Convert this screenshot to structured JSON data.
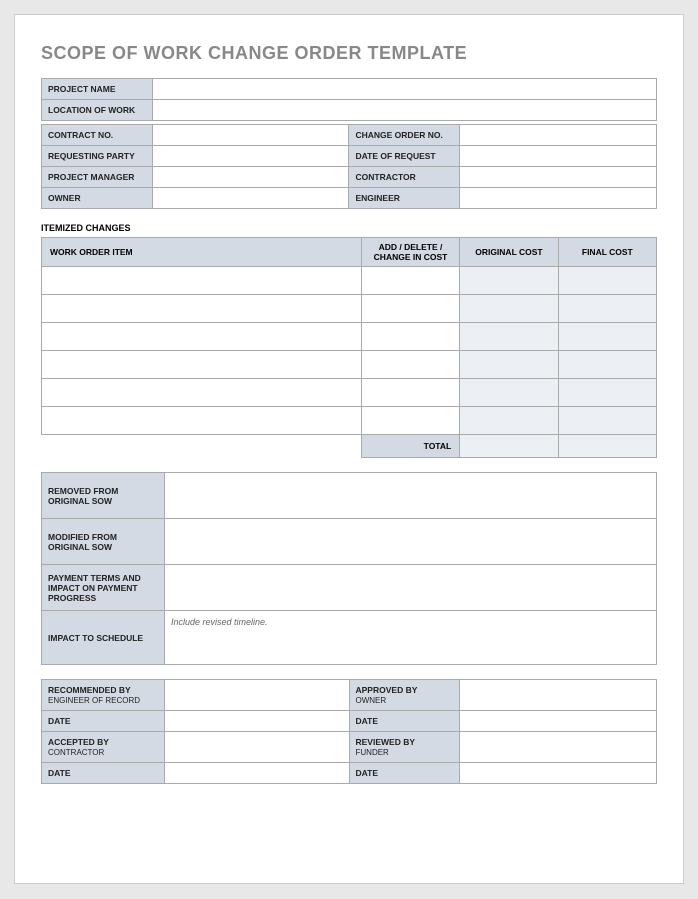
{
  "title": "SCOPE OF WORK CHANGE ORDER TEMPLATE",
  "info1": {
    "projectName_lbl": "PROJECT NAME",
    "projectName": "",
    "location_lbl": "LOCATION OF WORK",
    "location": "",
    "contractNo_lbl": "CONTRACT NO.",
    "contractNo": "",
    "changeOrderNo_lbl": "CHANGE ORDER NO.",
    "changeOrderNo": "",
    "requestingParty_lbl": "REQUESTING PARTY",
    "requestingParty": "",
    "dateOfRequest_lbl": "DATE OF REQUEST",
    "dateOfRequest": "",
    "projectManager_lbl": "PROJECT MANAGER",
    "projectManager": "",
    "contractor_lbl": "CONTRACTOR",
    "contractor": "",
    "owner_lbl": "OWNER",
    "owner": "",
    "engineer_lbl": "ENGINEER",
    "engineer": ""
  },
  "itemized": {
    "section_title": "ITEMIZED CHANGES",
    "headers": {
      "item": "WORK ORDER ITEM",
      "change": "ADD / DELETE / CHANGE IN COST",
      "original": "ORIGINAL COST",
      "final": "FINAL COST"
    },
    "rows": [
      {
        "item": "",
        "change": "",
        "original": "",
        "final": ""
      },
      {
        "item": "",
        "change": "",
        "original": "",
        "final": ""
      },
      {
        "item": "",
        "change": "",
        "original": "",
        "final": ""
      },
      {
        "item": "",
        "change": "",
        "original": "",
        "final": ""
      },
      {
        "item": "",
        "change": "",
        "original": "",
        "final": ""
      },
      {
        "item": "",
        "change": "",
        "original": "",
        "final": ""
      }
    ],
    "total_lbl": "TOTAL",
    "total_original": "",
    "total_final": ""
  },
  "descriptions": {
    "removed_lbl": "REMOVED FROM ORIGINAL SOW",
    "removed": "",
    "modified_lbl": "MODIFIED FROM ORIGINAL SOW",
    "modified": "",
    "payment_lbl": "PAYMENT TERMS AND IMPACT ON PAYMENT PROGRESS",
    "payment": "",
    "schedule_lbl": "IMPACT TO SCHEDULE",
    "schedule_hint": "Include revised timeline."
  },
  "approvals": {
    "recommended_lbl": "RECOMMENDED BY",
    "recommended_sub": "ENGINEER OF RECORD",
    "recommended": "",
    "approved_lbl": "APPROVED BY",
    "approved_sub": "OWNER",
    "approved": "",
    "date1_lbl": "DATE",
    "date1a": "",
    "date1b_lbl": "DATE",
    "date1b": "",
    "accepted_lbl": "ACCEPTED BY",
    "accepted_sub": "CONTRACTOR",
    "accepted": "",
    "reviewed_lbl": "REVIEWED BY",
    "reviewed_sub": "FUNDER",
    "reviewed": "",
    "date2_lbl": "DATE",
    "date2a": "",
    "date2b_lbl": "DATE",
    "date2b": ""
  }
}
